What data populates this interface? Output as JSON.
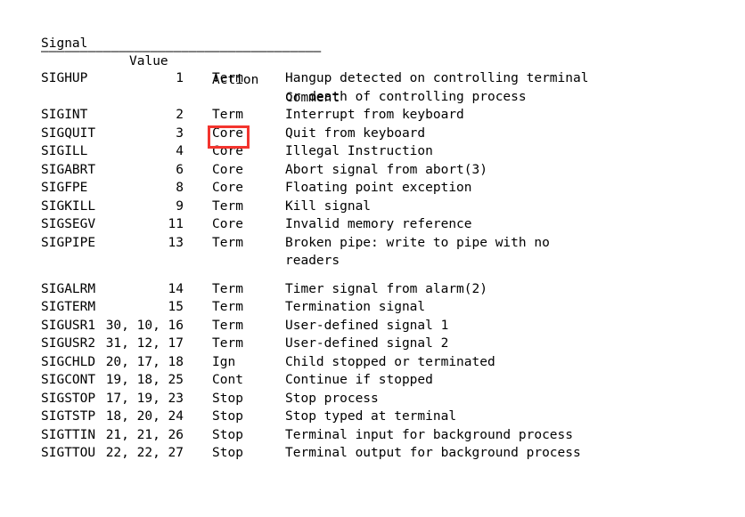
{
  "document": {
    "kind": "man-page-signal-table",
    "background_color": "#ffffff",
    "text_color": "#000000"
  },
  "table": {
    "headers": {
      "signal": "Signal",
      "value": "Value",
      "action": "Action",
      "comment": "Comment"
    },
    "separator": "————————————————————————————————————",
    "rows": [
      {
        "signal": "SIGHUP",
        "value": "1",
        "action": "Term",
        "comment": "Hangup detected on controlling terminal",
        "comment2": "or death of controlling process"
      },
      {
        "signal": "SIGINT",
        "value": "2",
        "action": "Term",
        "comment": "Interrupt from keyboard",
        "comment2": ""
      },
      {
        "signal": "SIGQUIT",
        "value": "3",
        "action": "Core",
        "comment": "Quit from keyboard",
        "comment2": ""
      },
      {
        "signal": "SIGILL",
        "value": "4",
        "action": "Core",
        "comment": "Illegal Instruction",
        "comment2": ""
      },
      {
        "signal": "SIGABRT",
        "value": "6",
        "action": "Core",
        "comment": "Abort signal from abort(3)",
        "comment2": ""
      },
      {
        "signal": "SIGFPE",
        "value": "8",
        "action": "Core",
        "comment": "Floating point exception",
        "comment2": ""
      },
      {
        "signal": "SIGKILL",
        "value": "9",
        "action": "Term",
        "comment": "Kill signal",
        "comment2": ""
      },
      {
        "signal": "SIGSEGV",
        "value": "11",
        "action": "Core",
        "comment": "Invalid memory reference",
        "comment2": ""
      },
      {
        "signal": "SIGPIPE",
        "value": "13",
        "action": "Term",
        "comment": "Broken pipe: write to pipe with no",
        "comment2": "readers"
      },
      {
        "signal": "SIGALRM",
        "value": "14",
        "action": "Term",
        "comment": "Timer signal from alarm(2)",
        "comment2": ""
      },
      {
        "signal": "SIGTERM",
        "value": "15",
        "action": "Term",
        "comment": "Termination signal",
        "comment2": ""
      },
      {
        "signal": "SIGUSR1",
        "value": "30, 10, 16",
        "action": "Term",
        "comment": "User-defined signal 1",
        "comment2": ""
      },
      {
        "signal": "SIGUSR2",
        "value": "31, 12, 17",
        "action": "Term",
        "comment": "User-defined signal 2",
        "comment2": ""
      },
      {
        "signal": "SIGCHLD",
        "value": "20, 17, 18",
        "action": "Ign",
        "comment": "Child stopped or terminated",
        "comment2": ""
      },
      {
        "signal": "SIGCONT",
        "value": "19, 18, 25",
        "action": "Cont",
        "comment": "Continue if stopped",
        "comment2": ""
      },
      {
        "signal": "SIGSTOP",
        "value": "17, 19, 23",
        "action": "Stop",
        "comment": "Stop process",
        "comment2": ""
      },
      {
        "signal": "SIGTSTP",
        "value": "18, 20, 24",
        "action": "Stop",
        "comment": "Stop typed at terminal",
        "comment2": ""
      },
      {
        "signal": "SIGTTIN",
        "value": "21, 21, 26",
        "action": "Stop",
        "comment": "Terminal input for background process",
        "comment2": ""
      },
      {
        "signal": "SIGTTOU",
        "value": "22, 22, 27",
        "action": "Stop",
        "comment": "Terminal output for background process",
        "comment2": ""
      }
    ]
  },
  "annotation": {
    "type": "rectangle-highlight",
    "target_row": "SIGQUIT",
    "target_column": "Action",
    "target_text": "Core",
    "color": "#f3342e"
  }
}
